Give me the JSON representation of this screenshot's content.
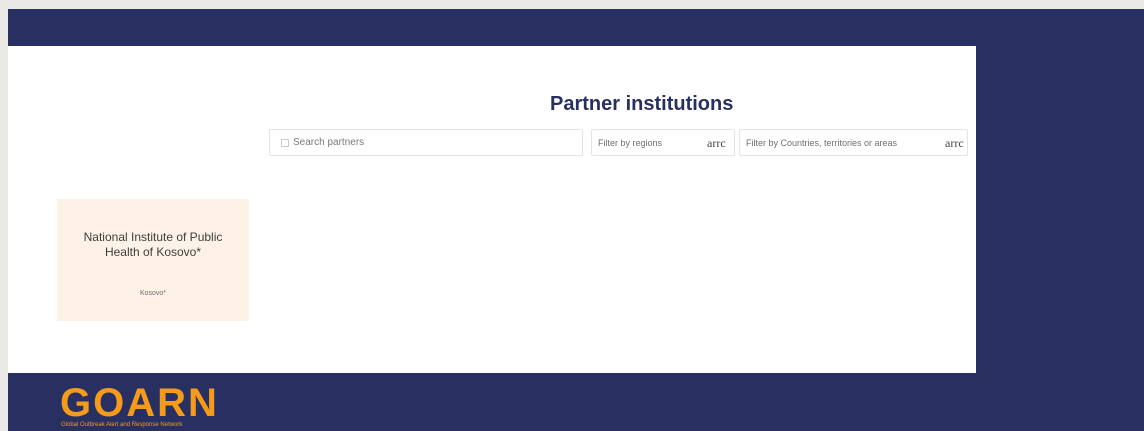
{
  "page": {
    "title": "Partner institutions"
  },
  "controls": {
    "search_placeholder": "Search partners",
    "regions_label": "Filter by regions",
    "countries_label": "Filter by Countries, territories or areas",
    "regions_arrow_text": "arrc",
    "countries_arrow_text": "arrc"
  },
  "partner_card": {
    "name": "National Institute of Public Health of Kosovo*",
    "country": "Kosovo*"
  },
  "footer": {
    "logo_text": "GOARN",
    "logo_subtitle": "Global Outbreak Alert and Response Network"
  },
  "colors": {
    "navy": "#283061",
    "panel": "#ffffff",
    "card": "#fef2e6",
    "accent": "#f59a1b"
  },
  "icons": {
    "search": "search-icon",
    "dropdown": "arrow-text"
  }
}
